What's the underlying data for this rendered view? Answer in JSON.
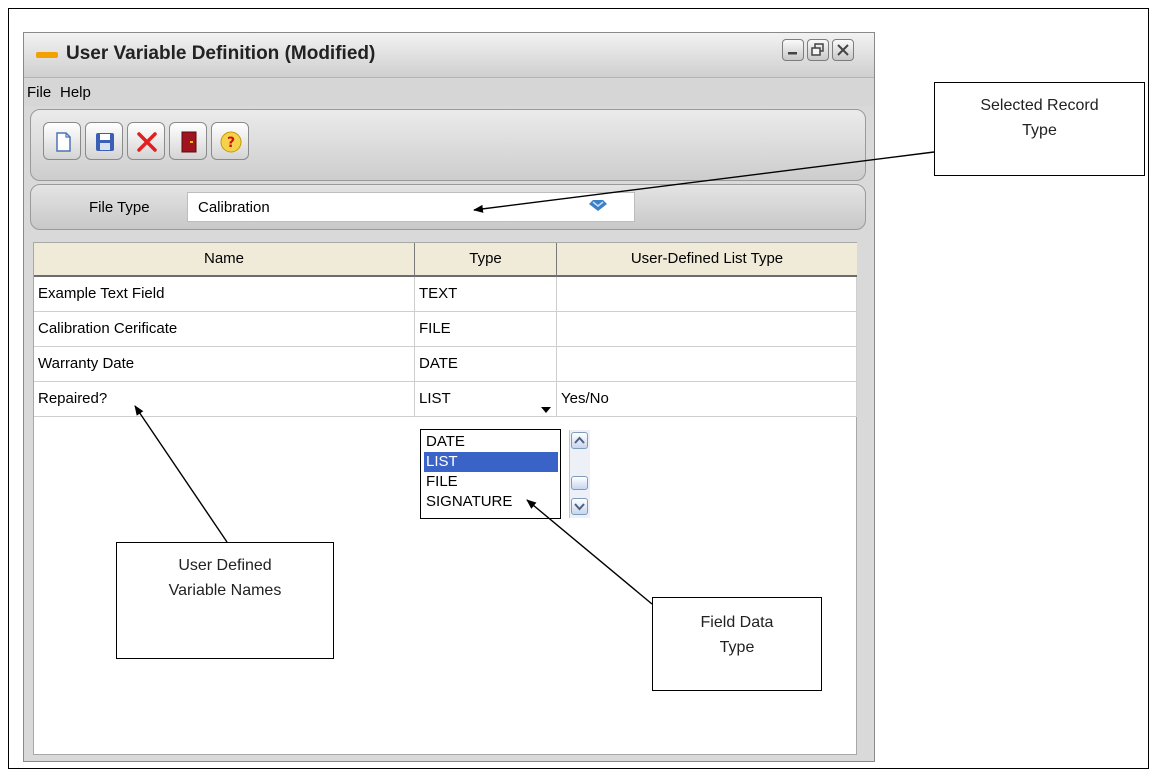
{
  "window": {
    "title": "User  Variable Definition (Modified)",
    "controls": {
      "minimize": "minimize-icon",
      "restore": "restore-icon",
      "close": "close-icon"
    }
  },
  "menu": {
    "file": "File",
    "help": "Help"
  },
  "toolbar": {
    "buttons": [
      {
        "icon": "new-document-icon"
      },
      {
        "icon": "save-icon"
      },
      {
        "icon": "delete-icon",
        "color": "#e02020"
      },
      {
        "icon": "exit-icon",
        "color": "#a0141e"
      },
      {
        "icon": "help-icon",
        "color": "#f2c000"
      }
    ]
  },
  "file_type": {
    "label": "File Type",
    "value": "Calibration",
    "dropdown_icon": "dropdown-icon"
  },
  "table": {
    "columns": [
      "Name",
      "Type",
      "User-Defined List Type"
    ],
    "rows": [
      {
        "name": "Example Text Field",
        "type": "TEXT",
        "list_type": ""
      },
      {
        "name": "Calibration Cerificate",
        "type": "FILE",
        "list_type": ""
      },
      {
        "name": "Warranty Date",
        "type": "DATE",
        "list_type": ""
      },
      {
        "name": "Repaired?",
        "type": "LIST",
        "list_type": "Yes/No"
      }
    ]
  },
  "type_dropdown": {
    "options": [
      "DATE",
      "LIST",
      "FILE",
      "SIGNATURE"
    ],
    "selected": "LIST"
  },
  "callouts": {
    "selected_record": {
      "line1": "Selected Record",
      "line2": "Type"
    },
    "variable_names": {
      "line1": "User Defined",
      "line2": "Variable Names"
    },
    "field_type": {
      "line1": "Field Data",
      "line2": "Type"
    }
  },
  "colors": {
    "selection": "#3a63c7",
    "header_bg": "#f0ead8"
  }
}
